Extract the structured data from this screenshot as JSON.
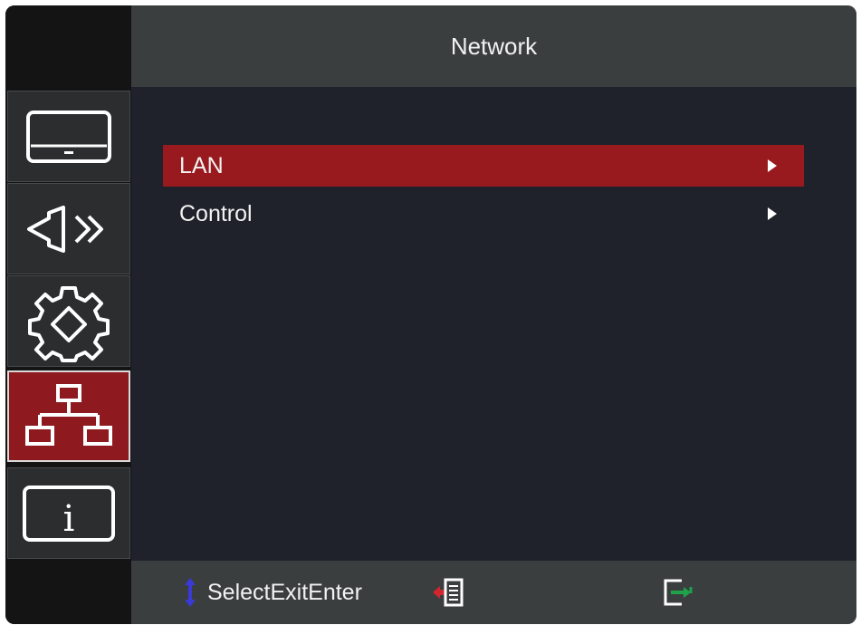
{
  "header": {
    "title": "Network"
  },
  "tabs": [
    {
      "icon": "display-icon",
      "active": false
    },
    {
      "icon": "projector-icon",
      "active": false
    },
    {
      "icon": "settings-gear-icon",
      "active": false
    },
    {
      "icon": "network-icon",
      "active": true
    },
    {
      "icon": "info-icon",
      "active": false
    }
  ],
  "menu": {
    "items": [
      {
        "label": "LAN",
        "selected": true
      },
      {
        "label": "Control",
        "selected": false
      }
    ]
  },
  "footer": {
    "hint_text": "SelectExitEnter",
    "icons": [
      "updown-arrow-icon",
      "exit-icon",
      "enter-icon"
    ]
  },
  "colors": {
    "accent": "#981a1e",
    "header_bg": "#3b3e3f",
    "content_bg": "#1f222b",
    "updown_icon": "#3a3ad6",
    "exit_icon": "#d0262e",
    "enter_icon": "#1fa24a"
  },
  "info_glyph": "i"
}
